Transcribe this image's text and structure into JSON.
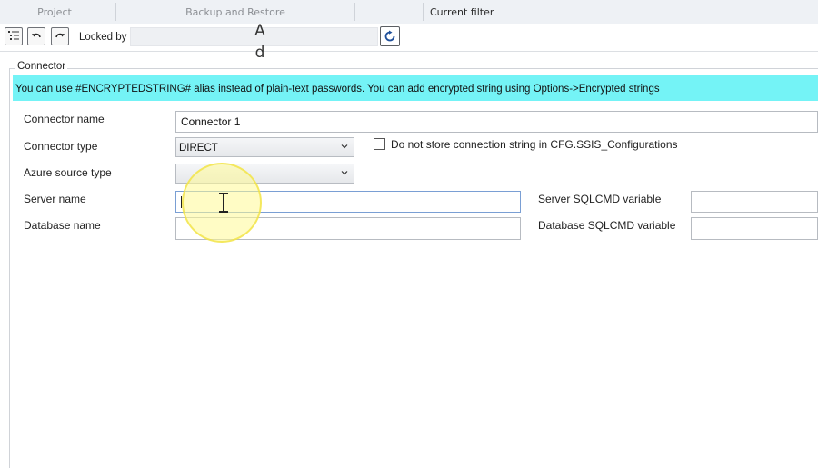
{
  "ribbon": {
    "groups": [
      "Project",
      "Backup and Restore",
      "Current filter"
    ]
  },
  "toolbar": {
    "locked_by_label": "Locked by",
    "locked_by_value": "",
    "overlay_text_line1": "A",
    "overlay_text_line2": "d"
  },
  "connector": {
    "group_title": "Connector",
    "info_message": "You can use #ENCRYPTEDSTRING# alias instead of plain-text passwords. You can add encrypted string using Options->Encrypted strings",
    "info_color": "#74f3f6",
    "fields": {
      "connector_name": {
        "label": "Connector name",
        "value": "Connector 1"
      },
      "connector_type": {
        "label": "Connector type",
        "value": "DIRECT"
      },
      "azure_source_type": {
        "label": "Azure source type",
        "value": ""
      },
      "server_name": {
        "label": "Server name",
        "value": ""
      },
      "database_name": {
        "label": "Database name",
        "value": ""
      },
      "server_sqlcmd_variable": {
        "label": "Server SQLCMD variable",
        "value": ""
      },
      "database_sqlcmd_variable": {
        "label": "Database SQLCMD variable",
        "value": ""
      }
    },
    "do_not_store_checkbox": {
      "label": "Do not store connection string in CFG.SSIS_Configurations",
      "checked": false
    }
  },
  "icons": {
    "toolbar": [
      "list-view-icon",
      "undo-icon",
      "redo-icon",
      "refresh-icon"
    ],
    "combo": "chevron-down-icon",
    "cursor": "text-cursor-icon"
  }
}
